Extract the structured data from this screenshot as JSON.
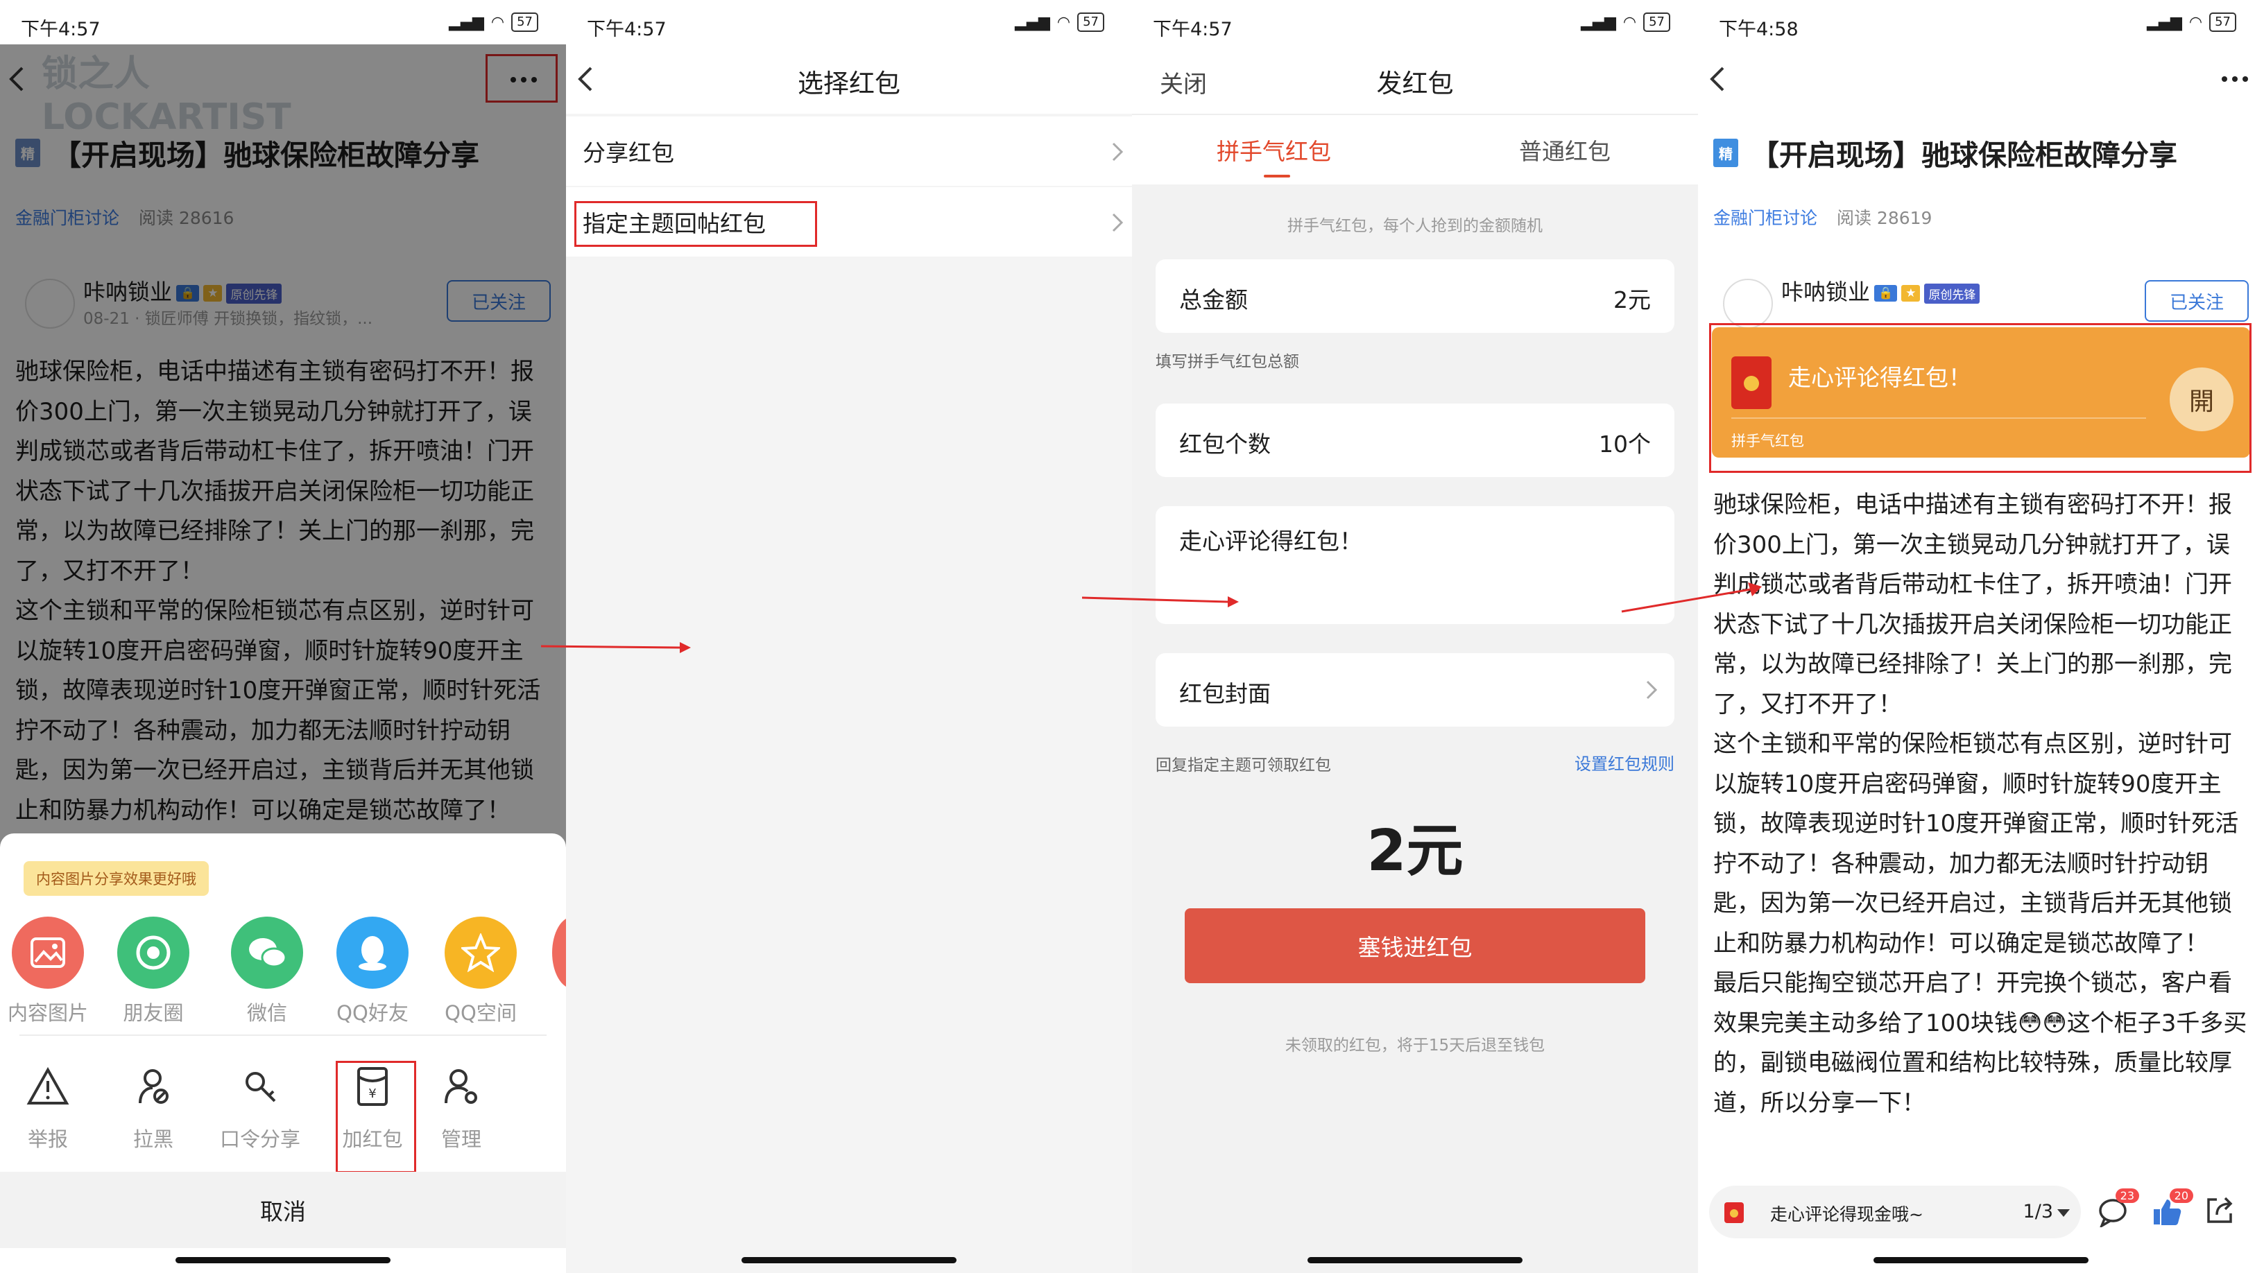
{
  "status": {
    "time_1": "下午4:57",
    "time_2": "下午4:57",
    "time_3": "下午4:57",
    "time_4": "下午4:58",
    "signal": "ᴴᴰ",
    "battery": "57"
  },
  "post": {
    "badge": "精",
    "title": "【开启现场】驰球保险柜故障分享",
    "forum": "金融门柜讨论",
    "reads_1": "阅读 28616",
    "reads_2": "阅读 28619",
    "author": "咔呐锁业",
    "author_sub": "08-21 · 锁匠师傅 开锁换锁，指纹锁，...",
    "tag_1": "原创先锋",
    "follow": "已关注",
    "watermark": "锁之人 LOCKARTIST",
    "body_1": "驰球保险柜，电话中描述有主锁有密码打不开！报价300上门，第一次主锁晃动几分钟就打开了，误判成锁芯或者背后带动杠卡住了，拆开喷油！门开状态下试了十几次插拔开启关闭保险柜一切功能正常，以为故障已经排除了！关上门的那一刹那，完了，又打不开了！",
    "body_2": "这个主锁和平常的保险柜锁芯有点区别，逆时针可以旋转10度开启密码弹窗，顺时针旋转90度开主锁，故障表现逆时针10度开弹窗正常，顺时针死活拧不动了！各种震动，加力都无法顺时针拧动钥匙，因为第一次已经开启过，主锁背后并无其他锁止和防暴力机构动作！可以确定是锁芯故障了！",
    "body_3": "最后只能掏空锁芯开启了！开完换个锁芯，客户看效果完美主动多给了100块钱😳😳这个柜子3千多买的，副锁电磁阀位置和结构比较特殊，质量比较厚道，所以分享一下！"
  },
  "share_sheet": {
    "tip": "内容图片分享效果更好哦",
    "share_items": [
      {
        "label": "内容图片",
        "color": "#ef6a5e"
      },
      {
        "label": "朋友圈",
        "color": "#3fc07a"
      },
      {
        "label": "微信",
        "color": "#3fc07a"
      },
      {
        "label": "QQ好友",
        "color": "#33a8f2"
      },
      {
        "label": "QQ空间",
        "color": "#f7b524"
      }
    ],
    "tools": [
      {
        "label": "举报",
        "icon": "warning-icon"
      },
      {
        "label": "拉黑",
        "icon": "block-user-icon"
      },
      {
        "label": "口令分享",
        "icon": "key-icon"
      },
      {
        "label": "加红包",
        "icon": "red-packet-icon"
      },
      {
        "label": "管理",
        "icon": "user-gear-icon"
      }
    ],
    "cancel": "取消"
  },
  "select_packet": {
    "title": "选择红包",
    "items": [
      "分享红包",
      "指定主题回帖红包"
    ]
  },
  "send_packet": {
    "close": "关闭",
    "title": "发红包",
    "tab_lucky": "拼手气红包",
    "tab_normal": "普通红包",
    "lucky_hint": "拼手气红包，每个人抢到的金额随机",
    "total_label": "总金额",
    "total_value": "2元",
    "total_hint": "填写拼手气红包总额",
    "count_label": "红包个数",
    "count_value": "10个",
    "message": "走心评论得红包！",
    "cover_label": "红包封面",
    "reply_hint": "回复指定主题可领取红包",
    "rules_link": "设置红包规则",
    "amount": "2元",
    "submit": "塞钱进红包",
    "refund_hint": "未领取的红包，将于15天后退至钱包"
  },
  "result": {
    "packet_title": "走心评论得红包！",
    "packet_type": "拼手气红包",
    "open": "開",
    "bar_text": "走心评论得现金哦~",
    "bar_page": "1/3",
    "comment_count": "23",
    "like_count": "20"
  }
}
